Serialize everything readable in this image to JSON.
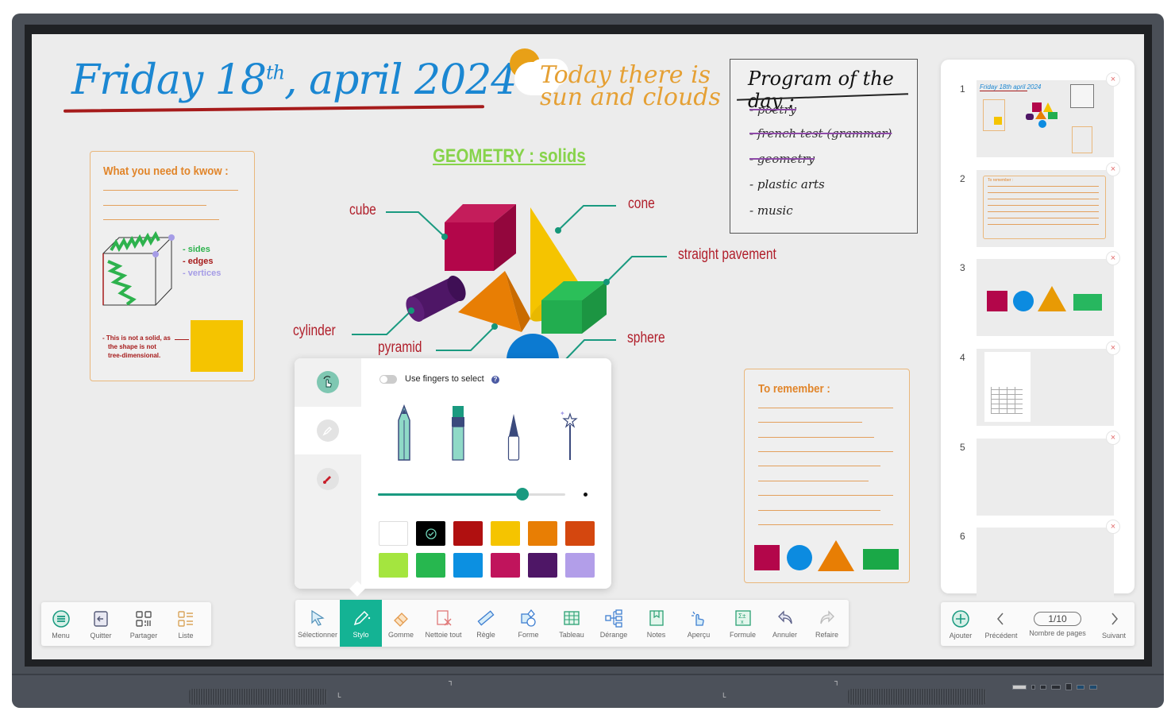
{
  "board": {
    "date_title": {
      "main": "Friday 18",
      "sup": "th",
      "rest": ", april 2024"
    },
    "weather": {
      "text": "Today there is sun and clouds"
    },
    "program": {
      "title": "Program of the day :",
      "items": [
        {
          "label": "- poetry",
          "done": true
        },
        {
          "label": "- french test (grammar)",
          "done": true
        },
        {
          "label": "- geometry",
          "done": true
        },
        {
          "label": "- plastic arts",
          "done": false
        },
        {
          "label": "- music",
          "done": false
        }
      ]
    },
    "geometry_title": "GEOMETRY : solids",
    "solids": {
      "cube": "cube",
      "cone": "cone",
      "straight_pavement": "straight pavement",
      "cylinder": "cylinder",
      "pyramid": "pyramid",
      "sphere": "sphere"
    },
    "know_card": {
      "title": "What you need to kwow :",
      "sides": "- sides",
      "edges": "- edges",
      "vertices": "- vertices",
      "note_line1": "- This is not a solid, as",
      "note_line2": "the shape is not",
      "note_line3": "tree-dimensional."
    },
    "remember_card": {
      "title": "To remember :"
    }
  },
  "pen_popup": {
    "toggle_label": "Use fingers to select",
    "toggle_on": false,
    "help": "?",
    "tools": [
      "pencil-icon",
      "marker-icon",
      "brush-icon",
      "magic-wand-icon"
    ],
    "thickness_percent": 77,
    "colors": [
      "#ffffff",
      "#000000",
      "#b01010",
      "#f5c400",
      "#e87e04",
      "#d4470f",
      "#a4e53f",
      "#27b74f",
      "#0c90e1",
      "#c0145c",
      "#4e1666",
      "#b29ee9"
    ],
    "selected_color_index": 1
  },
  "left_toolbar": [
    {
      "label": "Menu",
      "icon": "menu-icon"
    },
    {
      "label": "Quitter",
      "icon": "exit-icon"
    },
    {
      "label": "Partager",
      "icon": "qr-share-icon"
    },
    {
      "label": "Liste",
      "icon": "list-icon"
    }
  ],
  "main_toolbar": [
    {
      "label": "Sélectionner",
      "icon": "select-arrow-icon"
    },
    {
      "label": "Stylo",
      "icon": "pen-icon",
      "active": true
    },
    {
      "label": "Gomme",
      "icon": "eraser-icon"
    },
    {
      "label": "Nettoie tout",
      "icon": "clear-all-icon"
    },
    {
      "label": "Règle",
      "icon": "ruler-icon"
    },
    {
      "label": "Forme",
      "icon": "shapes-icon"
    },
    {
      "label": "Tableau",
      "icon": "table-icon"
    },
    {
      "label": "Dérange",
      "icon": "mindmap-icon"
    },
    {
      "label": "Notes",
      "icon": "notes-icon"
    },
    {
      "label": "Aperçu",
      "icon": "preview-touch-icon"
    },
    {
      "label": "Formule",
      "icon": "formula-icon"
    },
    {
      "label": "Annuler",
      "icon": "undo-icon"
    },
    {
      "label": "Refaire",
      "icon": "redo-icon"
    }
  ],
  "pages": {
    "items": [
      {
        "number": "1"
      },
      {
        "number": "2"
      },
      {
        "number": "3"
      },
      {
        "number": "4"
      },
      {
        "number": "5"
      },
      {
        "number": "6"
      }
    ],
    "page2_title": "To remember :",
    "close": "×"
  },
  "page_toolbar": {
    "add": "Ajouter",
    "previous": "Précédent",
    "counter": "1/10",
    "counter_label": "Nombre de pages",
    "next": "Suivant"
  }
}
